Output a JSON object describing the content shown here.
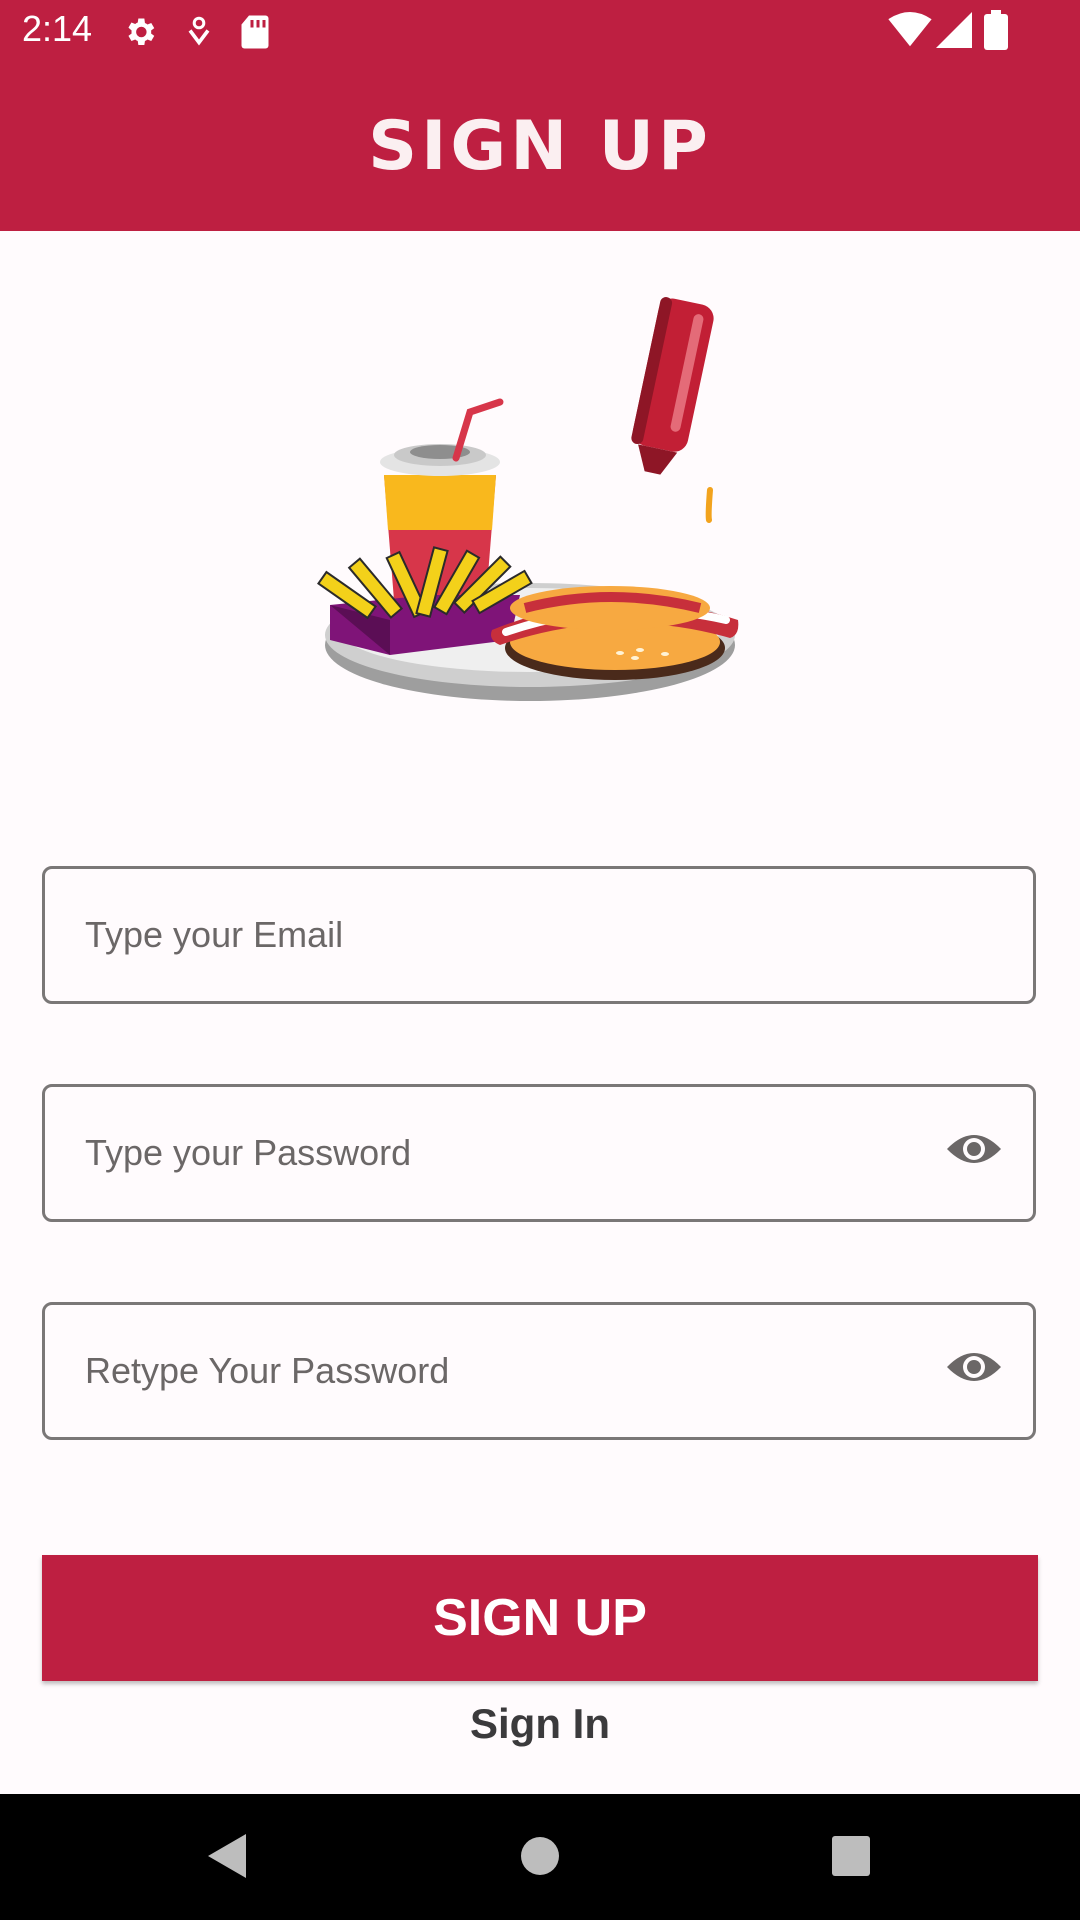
{
  "status_bar": {
    "time": "2:14",
    "icons": [
      "settings-icon",
      "notification-icon",
      "sd-card-icon",
      "wifi-icon",
      "signal-icon",
      "battery-icon"
    ]
  },
  "app_bar": {
    "title": "SIGN UP"
  },
  "colors": {
    "primary": "#BE1F41",
    "background": "#FFFBFD",
    "border": "#7A7777",
    "placeholder": "#6B6767"
  },
  "form": {
    "email": {
      "placeholder": "Type your Email"
    },
    "password": {
      "placeholder": "Type your Password",
      "toggle_icon": "eye-icon"
    },
    "retype_password": {
      "placeholder": "Retype Your Password",
      "toggle_icon": "eye-icon"
    },
    "signup_button": "SIGN UP",
    "signin_link": "Sign In"
  },
  "nav_bar": {
    "buttons": [
      "back-icon",
      "home-icon",
      "recents-icon"
    ]
  }
}
